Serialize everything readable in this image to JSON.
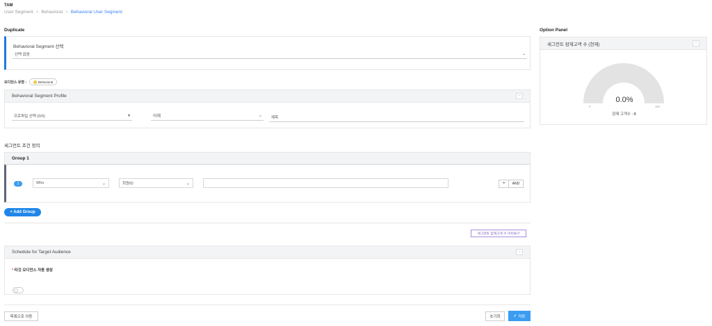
{
  "app": {
    "title": "TAM"
  },
  "breadcrumb": {
    "items": [
      "User Segment",
      "Behavioral",
      "Behavioral User Segment"
    ],
    "separator": ">"
  },
  "duplicate": {
    "title": "Duplicate",
    "field_label": "Behavioral Segment 선택",
    "select_value": "선택 없음"
  },
  "audience_type": {
    "label": "오디언스 유형 :",
    "badge": "Behavioral"
  },
  "profile": {
    "header": "Behavioral Segment Profile",
    "profile_select": "프로파일 선택 (0/0)",
    "date_select": "어제",
    "title_placeholder": "제목"
  },
  "condition": {
    "title": "세그먼트 조건 정의",
    "group_title": "Group 1",
    "row_number": "1",
    "who_select": "Who",
    "field_select": "회원ID",
    "value_input": "",
    "and_label": "AND",
    "minus_label": "−"
  },
  "add_group": {
    "label": "+ Add Group"
  },
  "preview_button": {
    "label": "세그먼트 잠재고객 수 미리보기"
  },
  "schedule": {
    "header": "Schedule for Target Audience",
    "required_mark": "*",
    "field_label": "타깃 오디언스 자동 생성",
    "toggle_on": false
  },
  "footer": {
    "back_label": "목록으로 이동",
    "reset_label": "초기화",
    "save_label": "저장",
    "save_icon": "check-icon"
  },
  "option_panel": {
    "title": "Option Panel",
    "card_header": "세그먼트 잠재고객 수 (현재)",
    "gauge_value": "0.0%",
    "gauge_fraction": 0,
    "gauge_min": "0",
    "gauge_max": "100",
    "count_label": "잠재 고객수 :",
    "count_value": "0"
  },
  "colors": {
    "accent": "#1f86e8",
    "duplicate_bar": "#1f7ae0",
    "group_bar": "#5b6677",
    "gauge_track": "#e3e3e3",
    "preview_border": "#a78bdb"
  },
  "icons": {
    "chevron": "chevron-down-icon",
    "collapse": "collapse-icon",
    "badge_dot": "status-dot-icon"
  }
}
